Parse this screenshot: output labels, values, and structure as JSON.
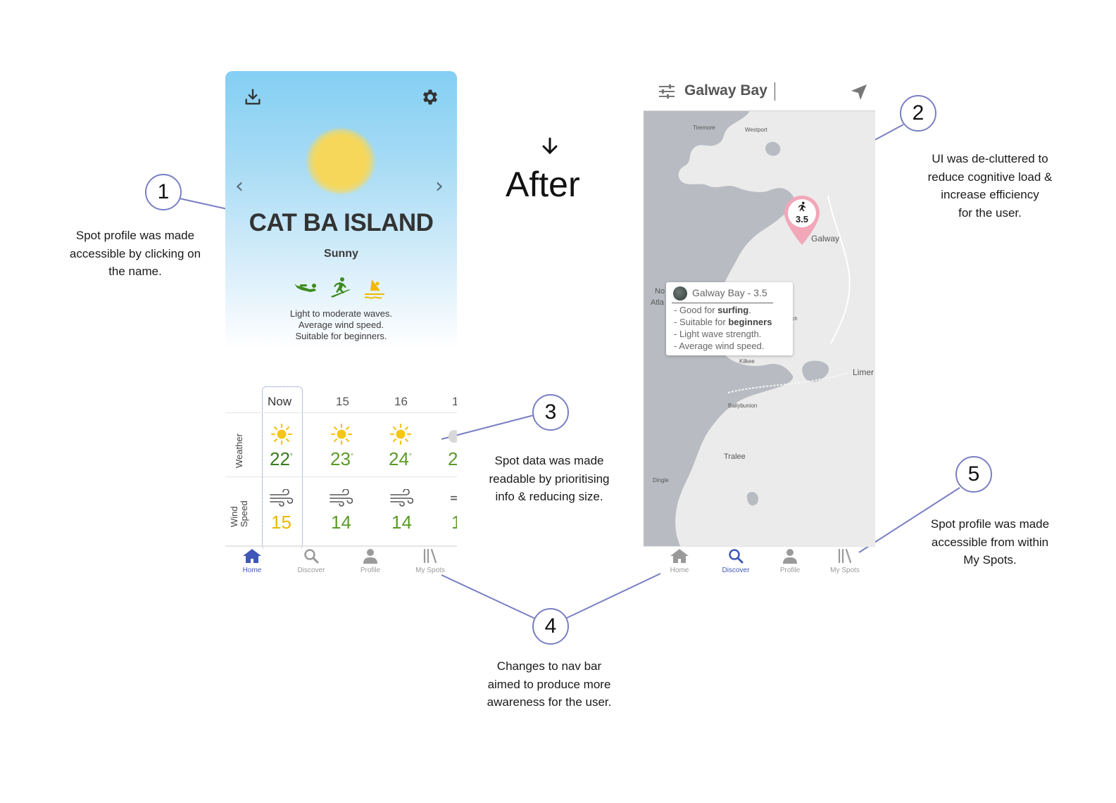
{
  "left_phone": {
    "spot_name": "CAT BA ISLAND",
    "condition": "Sunny",
    "description": [
      "Light to moderate waves.",
      "Average wind speed.",
      "Suitable for beginners."
    ],
    "activity_icons": [
      "scuba-diving-icon",
      "surfing-icon",
      "windsurfing-icon"
    ],
    "activity_colors": [
      "#3f8a1f",
      "#3f8a1f",
      "#f2b800"
    ],
    "forecast": {
      "columns": [
        "Now",
        "15",
        "16",
        "1"
      ],
      "row_labels": {
        "weather": "Weather",
        "wind_line1": "Wind",
        "wind_line2": "Speed"
      },
      "temperatures": [
        "22",
        "23",
        "24",
        "2"
      ],
      "degree_symbol": "°",
      "wind_speeds": [
        "15",
        "14",
        "14",
        "1"
      ],
      "wind_partial_glyph": "="
    },
    "nav": [
      {
        "label": "Home",
        "icon": "home-icon",
        "active": true
      },
      {
        "label": "Discover",
        "icon": "search-icon",
        "active": false
      },
      {
        "label": "Profile",
        "icon": "profile-icon",
        "active": false
      },
      {
        "label": "My Spots",
        "icon": "library-icon",
        "active": false
      }
    ]
  },
  "right_phone": {
    "search_value": "Galway Bay",
    "pin_rating": "3.5",
    "popup": {
      "title": "Galway Bay - 3.5",
      "line1_prefix": "- Good for ",
      "line1_bold": "surfing",
      "line1_suffix": ".",
      "line2_prefix": "- Suitable for ",
      "line2_bold": "beginners",
      "line3": "- Light wave strength.",
      "line4": "- Average wind speed."
    },
    "map_labels": {
      "tiremore": "Tiremore",
      "westport": "Westport",
      "galway": "Galway",
      "north_atlantic_1": "No",
      "north_atlantic_2": "Atla",
      "lahinch": "Lahinch",
      "kilkee": "Kilkee",
      "limerick": "Limer",
      "ballybunion": "Ballybunion",
      "tralee": "Tralee",
      "dingle": "Dingle"
    },
    "nav": [
      {
        "label": "Home",
        "icon": "home-icon",
        "active": false
      },
      {
        "label": "Discover",
        "icon": "search-icon",
        "active": true
      },
      {
        "label": "Profile",
        "icon": "profile-icon",
        "active": false
      },
      {
        "label": "My Spots",
        "icon": "library-icon",
        "active": false
      }
    ]
  },
  "heading": "After",
  "annotations": [
    {
      "number": "1",
      "lines": [
        "Spot profile was made",
        "accessible by clicking on",
        "the name."
      ]
    },
    {
      "number": "2",
      "lines": [
        "UI was de-cluttered to",
        "reduce cognitive load &",
        "increase efficiency",
        "for the user."
      ]
    },
    {
      "number": "3",
      "lines": [
        "Spot data was made",
        "readable by prioritising",
        "info & reducing size."
      ]
    },
    {
      "number": "4",
      "lines": [
        "Changes to nav bar",
        "aimed to produce more",
        "awareness for the user."
      ]
    },
    {
      "number": "5",
      "lines": [
        "Spot profile was made",
        "accessible from within",
        "My Spots."
      ]
    }
  ],
  "colors": {
    "accent": "#3f57b7",
    "annotation_stroke": "#7a7fc4",
    "pin": "#f2a7b8"
  }
}
